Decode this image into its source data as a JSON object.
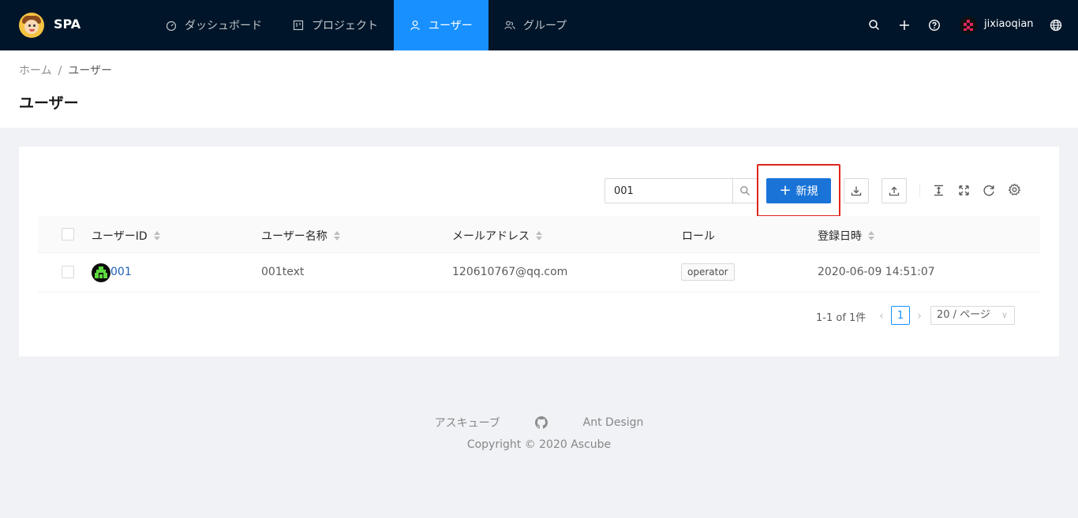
{
  "header": {
    "brand": "SPA",
    "nav": [
      {
        "label": "ダッシュボード",
        "icon": "dashboard-icon"
      },
      {
        "label": "プロジェクト",
        "icon": "project-icon"
      },
      {
        "label": "ユーザー",
        "icon": "user-icon",
        "active": true
      },
      {
        "label": "グループ",
        "icon": "group-icon"
      }
    ],
    "username": "jixiaoqian"
  },
  "breadcrumb": {
    "home": "ホーム",
    "separator": "/",
    "current": "ユーザー"
  },
  "page_title": "ユーザー",
  "toolbar": {
    "search_value": "001",
    "new_label": "新規"
  },
  "table": {
    "columns": [
      "ユーザーID",
      "ユーザー名称",
      "メールアドレス",
      "ロール",
      "登録日時"
    ],
    "rows": [
      {
        "id": "001",
        "name": "001text",
        "email": "120610767@qq.com",
        "role": "operator",
        "registered": "2020-06-09 14:51:07"
      }
    ]
  },
  "pagination": {
    "total_text": "1-1 of 1件",
    "current_page": "1",
    "page_size": "20 / ページ"
  },
  "footer": {
    "link_1": "アスキューブ",
    "link_2": "Ant Design",
    "copyright_prefix": "Copyright",
    "copyright_suffix": "2020 Ascube"
  },
  "colors": {
    "header_bg": "#001529",
    "primary": "#1890ff",
    "new_button": "#1a74d8",
    "highlight_border": "#e0241b"
  }
}
